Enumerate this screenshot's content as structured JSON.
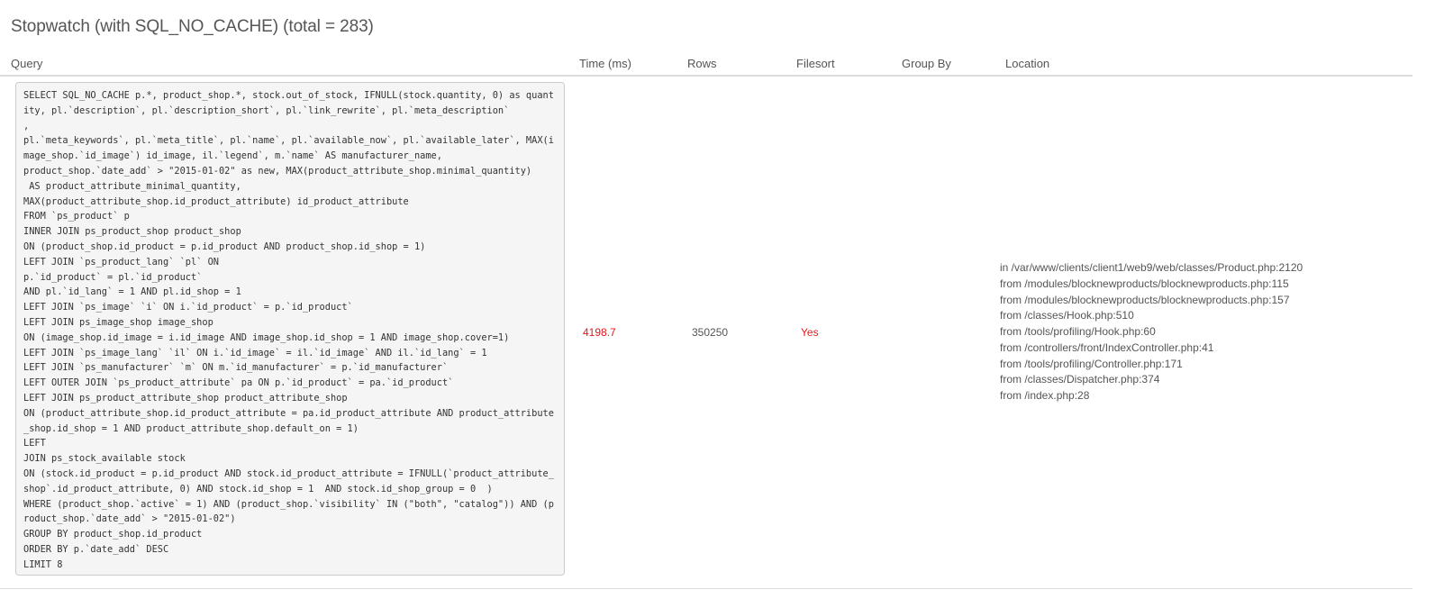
{
  "page": {
    "title": "Stopwatch (with SQL_NO_CACHE) (total = 283)"
  },
  "table": {
    "headers": {
      "query": "Query",
      "time": "Time (ms)",
      "rows": "Rows",
      "filesort": "Filesort",
      "group_by": "Group By",
      "location": "Location"
    },
    "rows": [
      {
        "query": "SELECT SQL_NO_CACHE p.*, product_shop.*, stock.out_of_stock, IFNULL(stock.quantity, 0) as quantity, pl.`description`, pl.`description_short`, pl.`link_rewrite`, pl.`meta_description`\n,\npl.`meta_keywords`, pl.`meta_title`, pl.`name`, pl.`available_now`, pl.`available_later`, MAX(image_shop.`id_image`) id_image, il.`legend`, m.`name` AS manufacturer_name,\nproduct_shop.`date_add` > \"2015-01-02\" as new, MAX(product_attribute_shop.minimal_quantity)\n AS product_attribute_minimal_quantity,\nMAX(product_attribute_shop.id_product_attribute) id_product_attribute\nFROM `ps_product` p\nINNER JOIN ps_product_shop product_shop\nON (product_shop.id_product = p.id_product AND product_shop.id_shop = 1)\nLEFT JOIN `ps_product_lang` `pl` ON\np.`id_product` = pl.`id_product`\nAND pl.`id_lang` = 1 AND pl.id_shop = 1\nLEFT JOIN `ps_image` `i` ON i.`id_product` = p.`id_product`\nLEFT JOIN ps_image_shop image_shop\nON (image_shop.id_image = i.id_image AND image_shop.id_shop = 1 AND image_shop.cover=1)\nLEFT JOIN `ps_image_lang` `il` ON i.`id_image` = il.`id_image` AND il.`id_lang` = 1\nLEFT JOIN `ps_manufacturer` `m` ON m.`id_manufacturer` = p.`id_manufacturer`\nLEFT OUTER JOIN `ps_product_attribute` pa ON p.`id_product` = pa.`id_product`\nLEFT JOIN ps_product_attribute_shop product_attribute_shop\nON (product_attribute_shop.id_product_attribute = pa.id_product_attribute AND product_attribute_shop.id_shop = 1 AND product_attribute_shop.default_on = 1)\nLEFT\nJOIN ps_stock_available stock\nON (stock.id_product = p.id_product AND stock.id_product_attribute = IFNULL(`product_attribute_shop`.id_product_attribute, 0) AND stock.id_shop = 1  AND stock.id_shop_group = 0  )\nWHERE (product_shop.`active` = 1) AND (product_shop.`visibility` IN (\"both\", \"catalog\")) AND (product_shop.`date_add` > \"2015-01-02\")\nGROUP BY product_shop.id_product\nORDER BY p.`date_add` DESC\nLIMIT 8",
        "time_ms": "4198.7",
        "rows": "350250",
        "filesort": "Yes",
        "group_by": "",
        "location": [
          "in /var/www/clients/client1/web9/web/classes/Product.php:2120",
          "from /modules/blocknewproducts/blocknewproducts.php:115",
          "from /modules/blocknewproducts/blocknewproducts.php:157",
          "from /classes/Hook.php:510",
          "from /tools/profiling/Hook.php:60",
          "from /controllers/front/IndexController.php:41",
          "from /tools/profiling/Controller.php:171",
          "from /classes/Dispatcher.php:374",
          "from /index.php:28"
        ]
      }
    ]
  },
  "colors": {
    "alert_red": "#e4171a",
    "text_gray": "#555555",
    "code_bg": "#f5f5f5"
  }
}
